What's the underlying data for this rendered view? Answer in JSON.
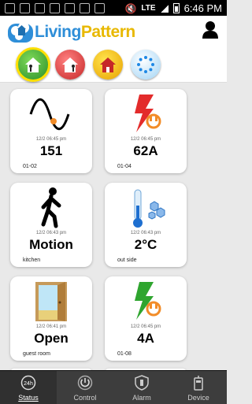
{
  "status_bar": {
    "network": "LTE",
    "time": "6:46 PM"
  },
  "header": {
    "brand_part1": "Living",
    "brand_part2": "Pattern"
  },
  "tiles": [
    {
      "timestamp": "12/2 06:45 pm",
      "value": "151",
      "sub": "01-02",
      "icon": "sine-wave-icon"
    },
    {
      "timestamp": "12/2 06:45 pm",
      "value": "62A",
      "sub": "01-04",
      "icon": "power-plug-icon"
    },
    {
      "timestamp": "12/2 06:43 pm",
      "value": "Motion",
      "sub": "kitchen",
      "icon": "walking-person-icon"
    },
    {
      "timestamp": "12/2 06:43 pm",
      "value": "2°C",
      "sub": "out side",
      "icon": "thermometer-icon"
    },
    {
      "timestamp": "12/2 06:41 pm",
      "value": "Open",
      "sub": "guest room",
      "icon": "door-icon"
    },
    {
      "timestamp": "12/2 06:45 pm",
      "value": "4A",
      "sub": "01-08",
      "icon": "power-plug-green-icon"
    }
  ],
  "bottom_nav": [
    {
      "label": "Status",
      "icon": "clock-24h-icon",
      "active": true
    },
    {
      "label": "Control",
      "icon": "power-icon"
    },
    {
      "label": "Alarm",
      "icon": "shield-icon"
    },
    {
      "label": "Device",
      "icon": "device-icon"
    }
  ],
  "colors": {
    "brand_blue": "#2e8ed8",
    "brand_yellow": "#e8b800",
    "active_ring": "#ffdf00"
  }
}
